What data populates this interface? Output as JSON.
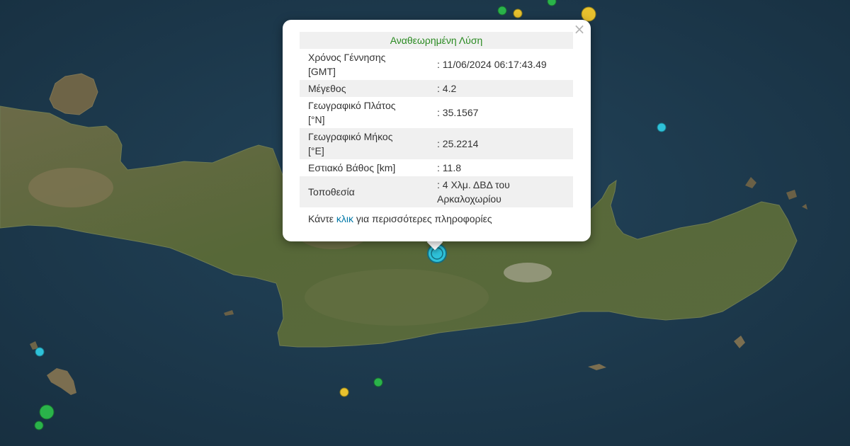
{
  "popup": {
    "title": "Αναθεωρημένη Λύση",
    "close_symbol": "×",
    "rows": [
      {
        "label": "Χρόνος Γέννησης [GMT]",
        "value": ": 11/06/2024 06:17:43.49"
      },
      {
        "label": "Μέγεθος",
        "value": ": 4.2"
      },
      {
        "label": "Γεωγραφικό Πλάτος [°N]",
        "value": ": 35.1567"
      },
      {
        "label": "Γεωγραφικό Μήκος [°E]",
        "value": ": 25.2214"
      },
      {
        "label": "Εστιακό Βάθος [km]",
        "value": ": 11.8"
      },
      {
        "label": "Τοποθεσία",
        "value": ": 4 Χλμ. ΔΒΔ του Αρκαλοχωρίου"
      }
    ],
    "footer_before": "Κάντε ",
    "footer_link": "κλικ",
    "footer_after": " για περισσότερες πληροφορίες"
  },
  "map": {
    "sea_color": "#1d3a4d",
    "land_color": "#596640",
    "marker_colors": {
      "green": "#2ab34a",
      "yellow": "#e8c12e",
      "cyan": "#2ec1d9",
      "selected": "#2ec1d9"
    }
  }
}
